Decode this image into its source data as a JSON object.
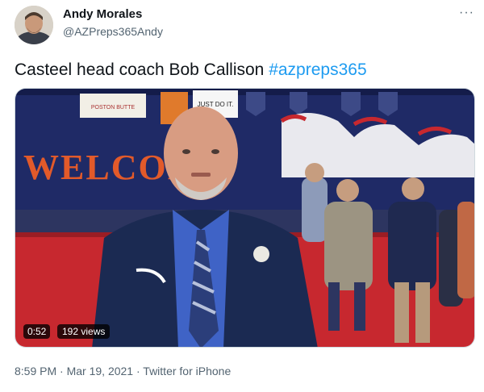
{
  "author": {
    "name": "Andy Morales",
    "handle": "@AZPreps365Andy"
  },
  "more_label": "···",
  "tweet": {
    "text": "Casteel head coach Bob Callison ",
    "hashtag": "#azpreps365"
  },
  "video": {
    "duration": "0:52",
    "views": "192 views",
    "wall_text": "WELCOM",
    "banner_text": "JUST DO IT.",
    "banner2_text": "POSTON BUTTE"
  },
  "meta": {
    "time": "8:59 PM",
    "separator1": " · ",
    "date": "Mar 19, 2021",
    "separator2": " · ",
    "source": "Twitter for iPhone"
  },
  "colors": {
    "accent": "#1d9bf0",
    "secondary_text": "#536471",
    "wall": "#1f2a66",
    "mat": "#c7282f"
  }
}
